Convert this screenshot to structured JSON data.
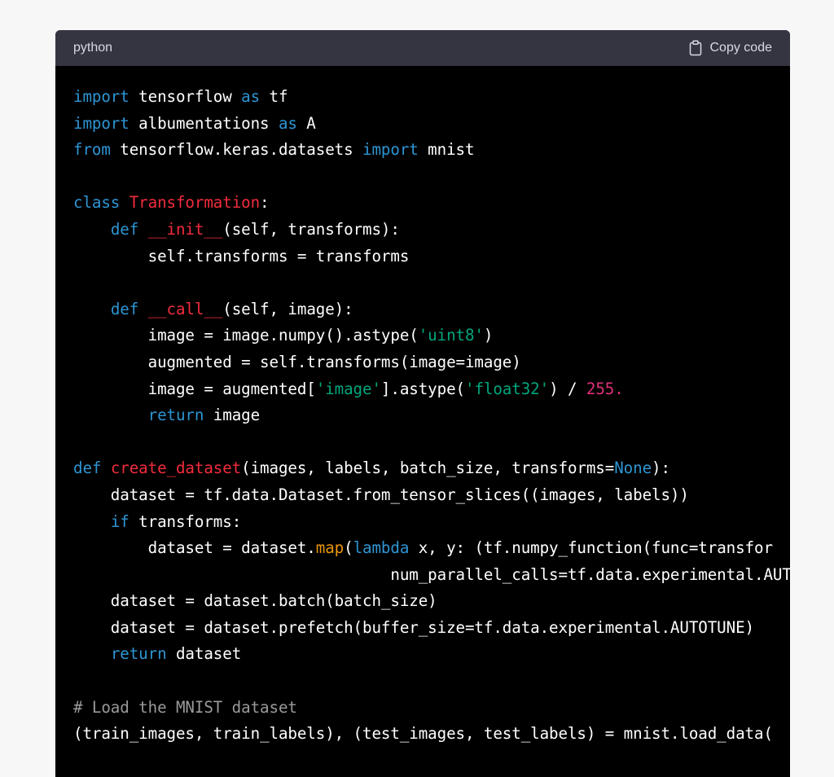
{
  "code_block": {
    "language": "python",
    "copy_label": "Copy code",
    "lines": [
      [
        {
          "t": "import",
          "c": "kw"
        },
        {
          "t": " tensorflow ",
          "c": "plain"
        },
        {
          "t": "as",
          "c": "kw"
        },
        {
          "t": " tf",
          "c": "plain"
        }
      ],
      [
        {
          "t": "import",
          "c": "kw"
        },
        {
          "t": " albumentations ",
          "c": "plain"
        },
        {
          "t": "as",
          "c": "kw"
        },
        {
          "t": " A",
          "c": "plain"
        }
      ],
      [
        {
          "t": "from",
          "c": "kw"
        },
        {
          "t": " tensorflow.keras.datasets ",
          "c": "plain"
        },
        {
          "t": "import",
          "c": "kw"
        },
        {
          "t": " mnist",
          "c": "plain"
        }
      ],
      [],
      [
        {
          "t": "class",
          "c": "kw"
        },
        {
          "t": " ",
          "c": "plain"
        },
        {
          "t": "Transformation",
          "c": "title"
        },
        {
          "t": ":",
          "c": "plain"
        }
      ],
      [
        {
          "t": "    ",
          "c": "plain"
        },
        {
          "t": "def",
          "c": "kw"
        },
        {
          "t": " ",
          "c": "plain"
        },
        {
          "t": "__init__",
          "c": "title"
        },
        {
          "t": "(self, transforms):",
          "c": "plain"
        }
      ],
      [
        {
          "t": "        self.transforms = transforms",
          "c": "plain"
        }
      ],
      [],
      [
        {
          "t": "    ",
          "c": "plain"
        },
        {
          "t": "def",
          "c": "kw"
        },
        {
          "t": " ",
          "c": "plain"
        },
        {
          "t": "__call__",
          "c": "title"
        },
        {
          "t": "(self, image):",
          "c": "plain"
        }
      ],
      [
        {
          "t": "        image = image.numpy().astype(",
          "c": "plain"
        },
        {
          "t": "'uint8'",
          "c": "str"
        },
        {
          "t": ")",
          "c": "plain"
        }
      ],
      [
        {
          "t": "        augmented = self.transforms(image=image)",
          "c": "plain"
        }
      ],
      [
        {
          "t": "        image = augmented[",
          "c": "plain"
        },
        {
          "t": "'image'",
          "c": "str"
        },
        {
          "t": "].astype(",
          "c": "plain"
        },
        {
          "t": "'float32'",
          "c": "str"
        },
        {
          "t": ") / ",
          "c": "plain"
        },
        {
          "t": "255.",
          "c": "num"
        }
      ],
      [
        {
          "t": "        ",
          "c": "plain"
        },
        {
          "t": "return",
          "c": "kw"
        },
        {
          "t": " image",
          "c": "plain"
        }
      ],
      [],
      [
        {
          "t": "def",
          "c": "kw"
        },
        {
          "t": " ",
          "c": "plain"
        },
        {
          "t": "create_dataset",
          "c": "title"
        },
        {
          "t": "(images, labels, batch_size, transforms=",
          "c": "plain"
        },
        {
          "t": "None",
          "c": "kw"
        },
        {
          "t": "):",
          "c": "plain"
        }
      ],
      [
        {
          "t": "    dataset = tf.data.Dataset.from_tensor_slices((images, labels))",
          "c": "plain"
        }
      ],
      [
        {
          "t": "    ",
          "c": "plain"
        },
        {
          "t": "if",
          "c": "kw"
        },
        {
          "t": " transforms:",
          "c": "plain"
        }
      ],
      [
        {
          "t": "        dataset = dataset.",
          "c": "plain"
        },
        {
          "t": "map",
          "c": "builtin"
        },
        {
          "t": "(",
          "c": "plain"
        },
        {
          "t": "lambda",
          "c": "kw"
        },
        {
          "t": " x, y: (tf.numpy_function(func=transfor",
          "c": "plain"
        }
      ],
      [
        {
          "t": "                                  num_parallel_calls=tf.data.experimental.AUTOTU",
          "c": "plain"
        }
      ],
      [
        {
          "t": "    dataset = dataset.batch(batch_size)",
          "c": "plain"
        }
      ],
      [
        {
          "t": "    dataset = dataset.prefetch(buffer_size=tf.data.experimental.AUTOTUNE)",
          "c": "plain"
        }
      ],
      [
        {
          "t": "    ",
          "c": "plain"
        },
        {
          "t": "return",
          "c": "kw"
        },
        {
          "t": " dataset",
          "c": "plain"
        }
      ],
      [],
      [
        {
          "t": "# Load the MNIST dataset",
          "c": "comment"
        }
      ],
      [
        {
          "t": "(train_images, train_labels), (test_images, test_labels) = mnist.load_data(",
          "c": "plain"
        }
      ]
    ]
  },
  "colors": {
    "page_bg": "#f7f7f8",
    "header_bg": "#343541",
    "code_bg": "#000000",
    "keyword": "#2e95d3",
    "title": "#f22c3d",
    "string": "#00a67d",
    "number": "#df3079",
    "builtin": "#e9950c",
    "comment": "#9a9a9a"
  },
  "icons": {
    "copy": "clipboard-icon"
  }
}
